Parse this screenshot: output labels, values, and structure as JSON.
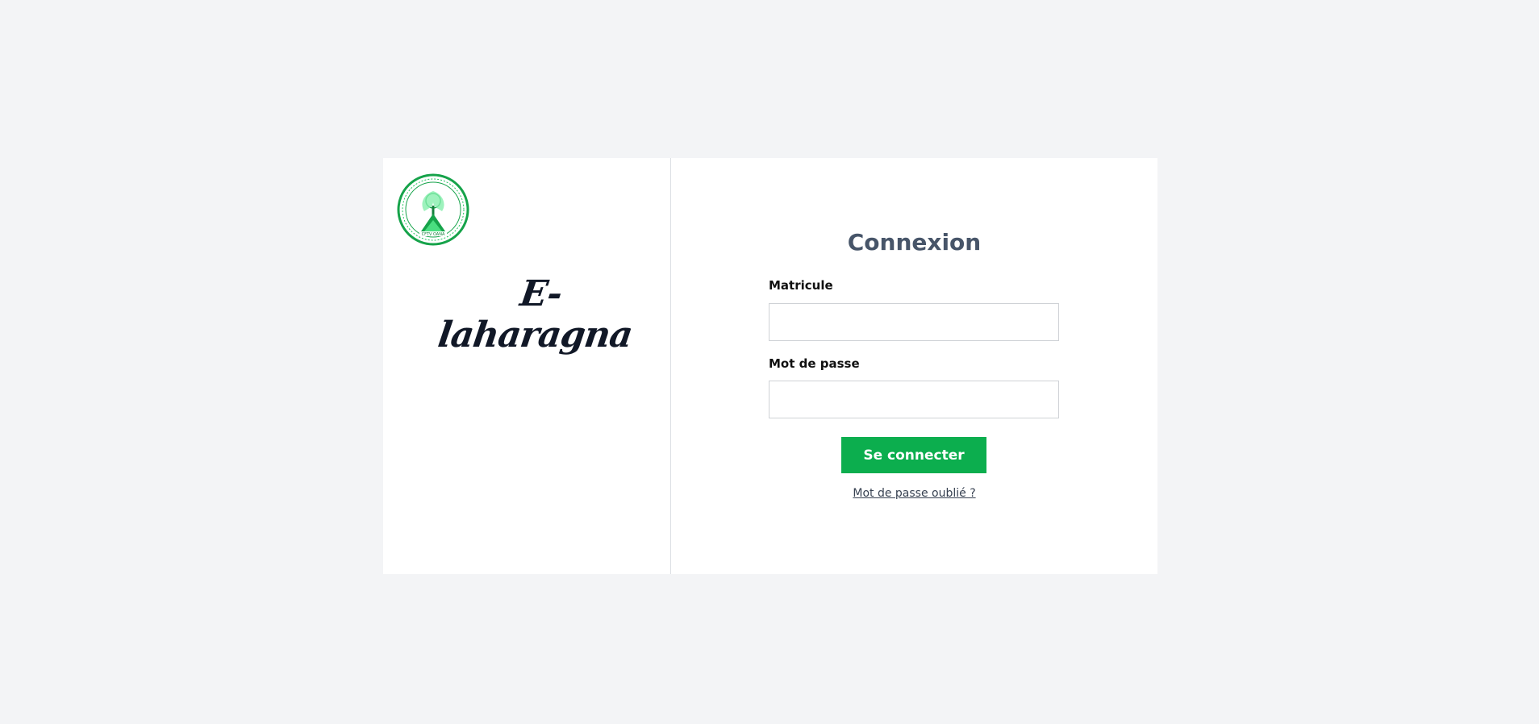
{
  "brand": {
    "name": "E-laharagna",
    "logo_icon": "circular-green-emblem-icon",
    "logo_text": "CFTV OANA"
  },
  "login": {
    "title": "Connexion",
    "matricule_label": "Matricule",
    "matricule_value": "",
    "password_label": "Mot de passe",
    "password_value": "",
    "submit_label": "Se connecter",
    "forgot_label": "Mot de passe oublié ?"
  },
  "colors": {
    "background": "#f3f4f6",
    "accent": "#0cae4e",
    "title": "#475569"
  }
}
